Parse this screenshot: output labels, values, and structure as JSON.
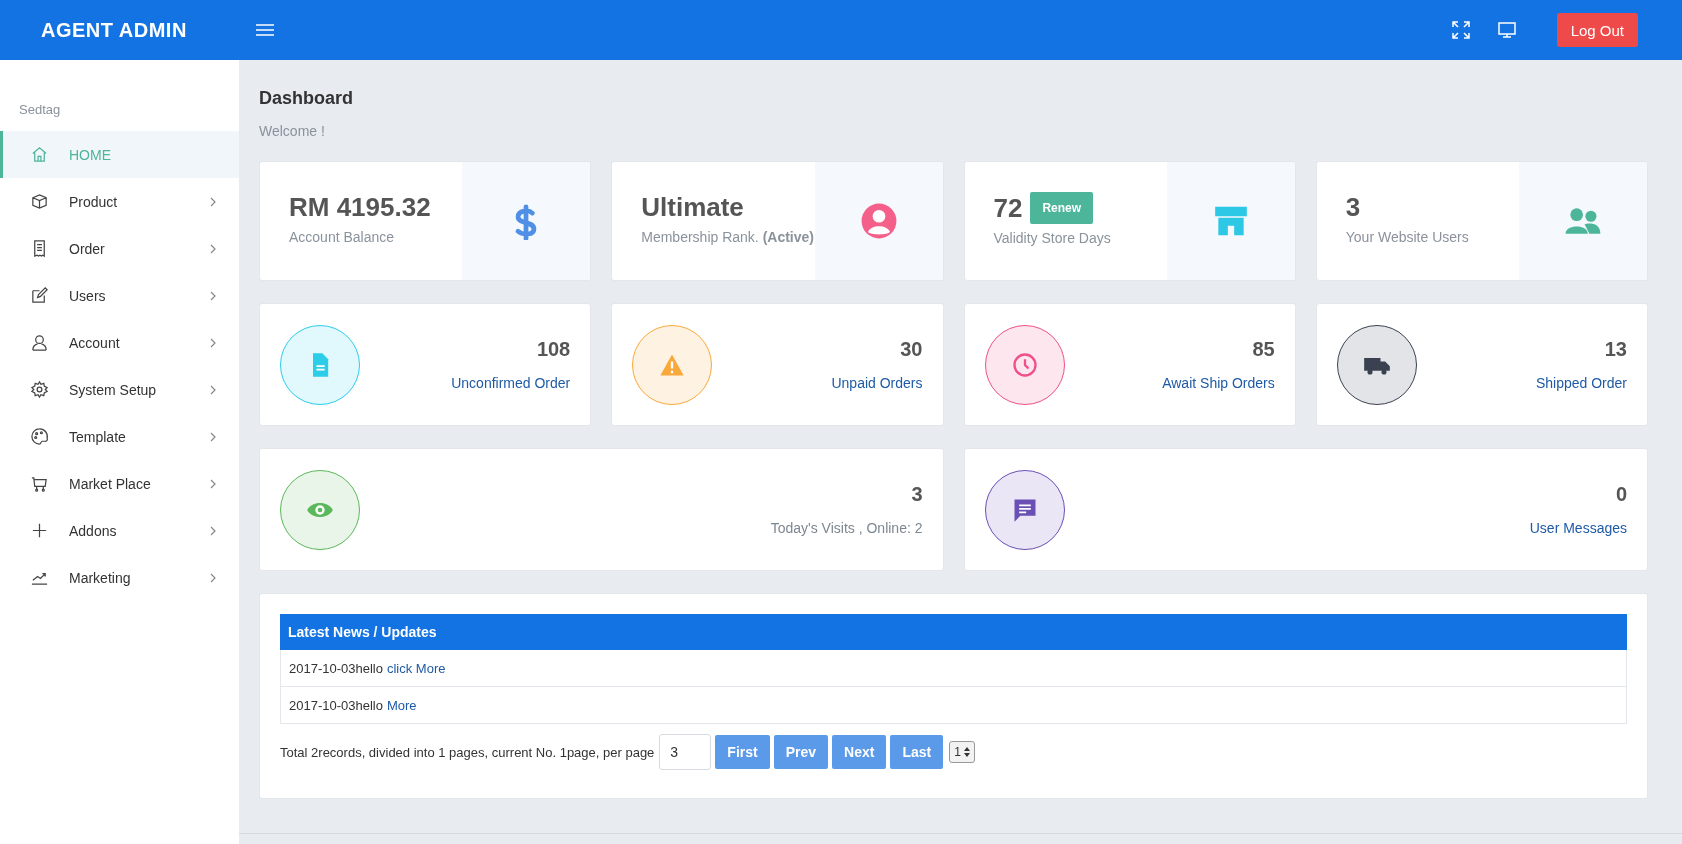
{
  "header": {
    "brand": "AGENT ADMIN",
    "logout": "Log Out"
  },
  "sidebar": {
    "section": "Sedtag",
    "items": [
      {
        "label": "HOME",
        "selected": true,
        "has_submenu": false
      },
      {
        "label": "Product",
        "selected": false,
        "has_submenu": true
      },
      {
        "label": "Order",
        "selected": false,
        "has_submenu": true
      },
      {
        "label": "Users",
        "selected": false,
        "has_submenu": true
      },
      {
        "label": "Account",
        "selected": false,
        "has_submenu": true
      },
      {
        "label": "System Setup",
        "selected": false,
        "has_submenu": true
      },
      {
        "label": "Template",
        "selected": false,
        "has_submenu": true
      },
      {
        "label": "Market Place",
        "selected": false,
        "has_submenu": true
      },
      {
        "label": "Addons",
        "selected": false,
        "has_submenu": true
      },
      {
        "label": "Marketing",
        "selected": false,
        "has_submenu": true
      }
    ]
  },
  "page": {
    "title": "Dashboard",
    "subtitle": "Welcome !"
  },
  "summary_cards": [
    {
      "value": "RM 4195.32",
      "label": "Account Balance",
      "color": "#4f8fe6"
    },
    {
      "value": "Ultimate",
      "label": "Membership Rank. **(Active)**",
      "color": "#f5608a"
    },
    {
      "value": "72",
      "button": "Renew",
      "label": "Validity Store Days",
      "color": "#2cc8e6"
    },
    {
      "value": "3",
      "label": "Your Website Users",
      "color": "#4cb59a"
    }
  ],
  "stat_cards": [
    {
      "value": "108",
      "label": "Unconfirmed Order",
      "kind": "link",
      "color": "#2ccde8"
    },
    {
      "value": "30",
      "label": "Unpaid Orders",
      "kind": "link",
      "color": "#f9a83a"
    },
    {
      "value": "85",
      "label": "Await Ship Orders",
      "kind": "link",
      "color": "#f0508a"
    },
    {
      "value": "13",
      "label": "Shipped Order",
      "kind": "link",
      "color": "#3a4252"
    },
    {
      "value": "3",
      "label": "Today's Visits , Online: 2",
      "kind": "text",
      "color": "#5cb85c"
    },
    {
      "value": "0",
      "label": "User Messages",
      "kind": "link",
      "color": "#6a4fb5"
    }
  ],
  "news": {
    "title": "Latest News / Updates",
    "items": [
      {
        "text": "2017-10-03hello",
        "link": "click More"
      },
      {
        "text": "2017-10-03hello",
        "link": "More"
      }
    ],
    "pagination": {
      "summary": "Total 2records, divided into 1 pages, current No. 1page, per page",
      "per_page": "3",
      "buttons": [
        "First",
        "Prev",
        "Next",
        "Last"
      ],
      "page_select": "1"
    }
  }
}
